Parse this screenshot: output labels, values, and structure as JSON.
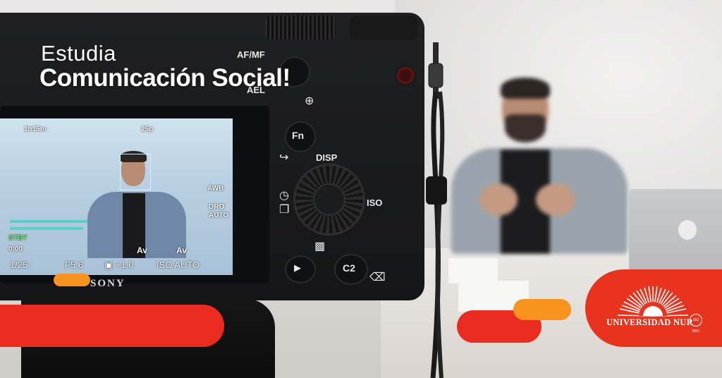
{
  "headline": {
    "line1": "Estudia",
    "line2": "Comunicación Social!"
  },
  "camera": {
    "brand": "SONY",
    "buttons": {
      "af_mf": "AF/MF",
      "ael": "AEL",
      "fn": "Fn",
      "disp": "DISP",
      "iso": "ISO",
      "c2": "C2"
    },
    "screen": {
      "battery_time": "1h15m",
      "fps": "25p",
      "stby": "STBY",
      "timecode": "0:00",
      "shutter": "1/25",
      "aperture": "F5.6",
      "exposure": "+1.0",
      "iso": "ISO AUTO",
      "mode_1": "Av",
      "mode_2": "Av",
      "awb": "AWB",
      "dro": "DRO",
      "dro_value": "AUTO"
    }
  },
  "logo": {
    "name": "UNIVERSIDAD NUR",
    "seal": "ISO 9001"
  },
  "colors": {
    "brand_red": "#ea2b20",
    "brand_orange": "#f7931e"
  }
}
